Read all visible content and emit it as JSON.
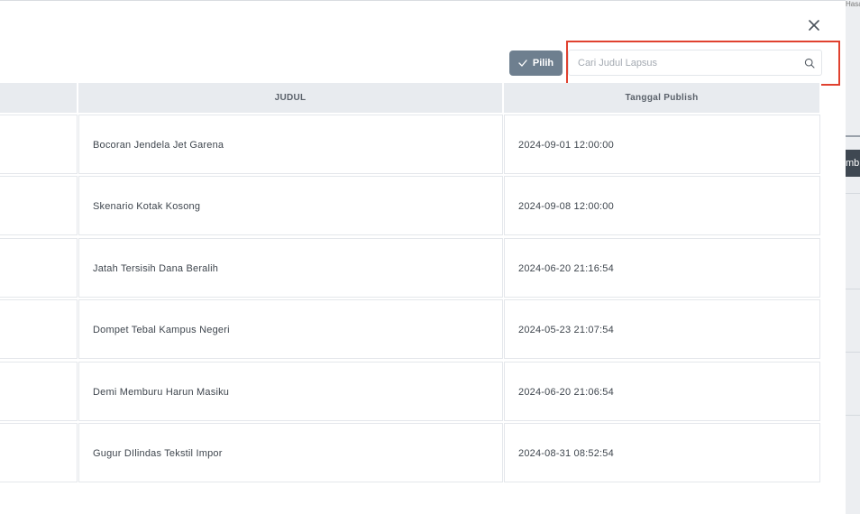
{
  "background_page": {
    "side_text": "mb",
    "top_text": "Hasan Bas"
  },
  "modal": {
    "close_icon": "close-icon",
    "pilih_label": "Pilih",
    "pilih_icon": "check-icon",
    "search": {
      "placeholder": "Cari Judul Lapsus",
      "value": "",
      "icon": "search-icon"
    },
    "highlight_color": "#e0412f",
    "button_color": "#6e7f8f",
    "table": {
      "columns": [
        "",
        "JUDUL",
        "Tanggal Publish"
      ],
      "rows": [
        {
          "judul": "Bocoran Jendela Jet Garena",
          "tanggal": "2024-09-01 12:00:00"
        },
        {
          "judul": "Skenario Kotak Kosong",
          "tanggal": "2024-09-08 12:00:00"
        },
        {
          "judul": "Jatah Tersisih Dana Beralih",
          "tanggal": "2024-06-20 21:16:54"
        },
        {
          "judul": "Dompet Tebal Kampus Negeri",
          "tanggal": "2024-05-23 21:07:54"
        },
        {
          "judul": "Demi Memburu Harun Masiku",
          "tanggal": "2024-06-20 21:06:54"
        },
        {
          "judul": "Gugur DIlindas Tekstil Impor",
          "tanggal": "2024-08-31 08:52:54"
        }
      ]
    }
  }
}
